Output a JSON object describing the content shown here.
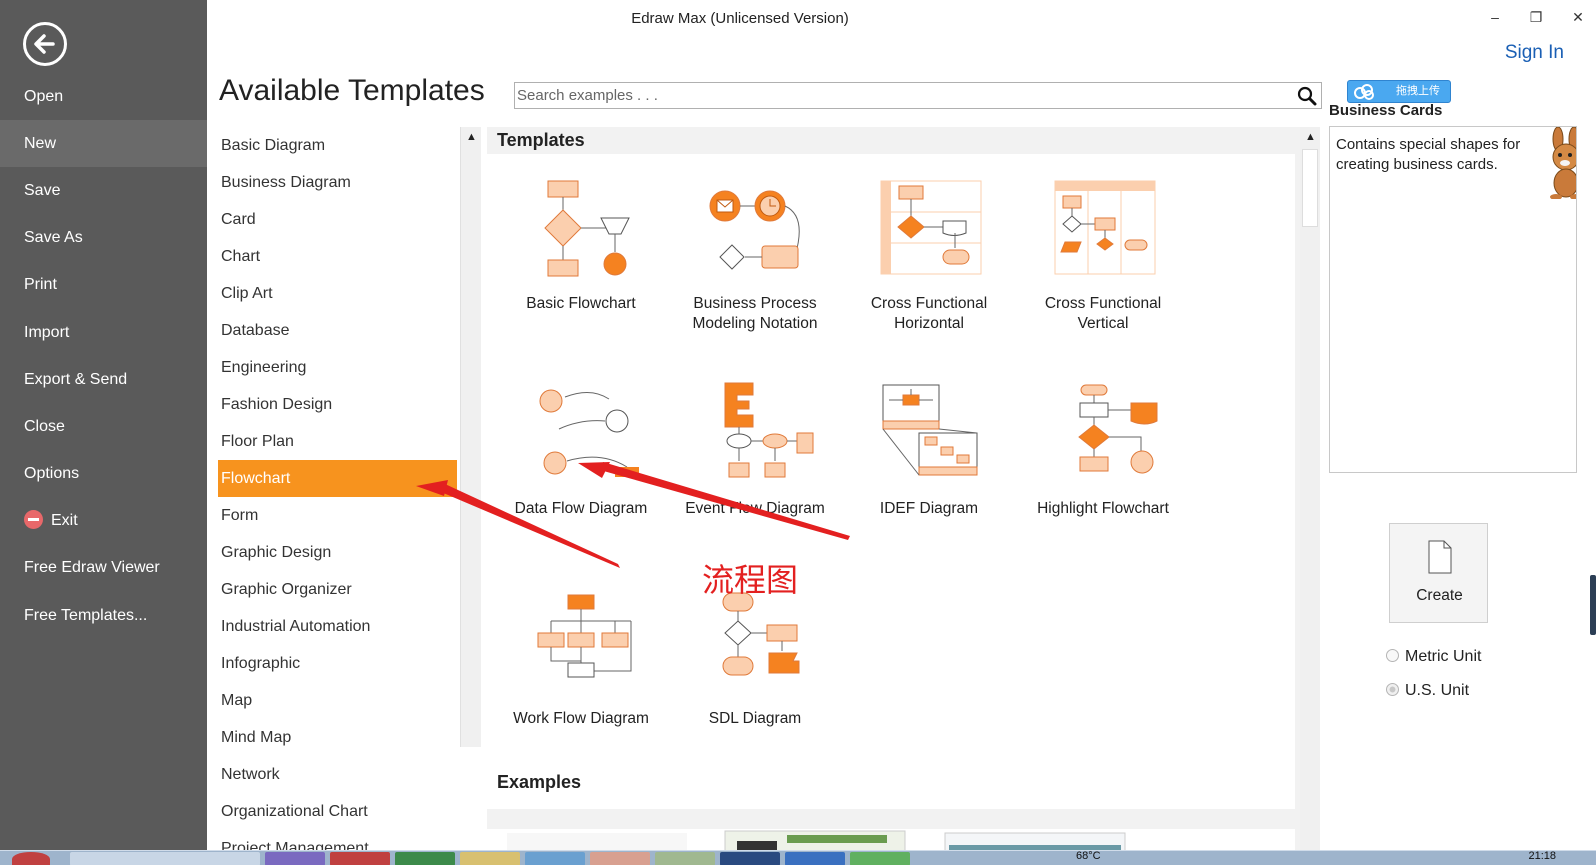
{
  "window": {
    "title": "Edraw Max (Unlicensed Version)",
    "sign_in": "Sign In",
    "minimize": "–",
    "restore": "❐",
    "close": "✕"
  },
  "leftnav": {
    "items": [
      {
        "label": "Open"
      },
      {
        "label": "New"
      },
      {
        "label": "Save"
      },
      {
        "label": "Save As"
      },
      {
        "label": "Print"
      },
      {
        "label": "Import"
      },
      {
        "label": "Export & Send"
      },
      {
        "label": "Close"
      },
      {
        "label": "Options"
      },
      {
        "label": "Exit",
        "icon": "exit-icon"
      },
      {
        "label": "Free Edraw Viewer"
      },
      {
        "label": "Free Templates..."
      }
    ],
    "active": "New",
    "back_icon": "back-arrow-icon"
  },
  "heading": "Available Templates",
  "search": {
    "placeholder": "Search examples . . .",
    "icon": "search-icon"
  },
  "categories": [
    "Basic Diagram",
    "Business Diagram",
    "Card",
    "Chart",
    "Clip Art",
    "Database",
    "Engineering",
    "Fashion Design",
    "Floor Plan",
    "Flowchart",
    "Form",
    "Graphic Design",
    "Graphic Organizer",
    "Industrial Automation",
    "Infographic",
    "Map",
    "Mind Map",
    "Network",
    "Organizational Chart",
    "Project Management"
  ],
  "selected_category": "Flowchart",
  "templates_section": "Templates",
  "examples_section": "Examples",
  "templates": [
    {
      "label_line1": "Basic Flowchart",
      "label_line2": ""
    },
    {
      "label_line1": "Business Process",
      "label_line2": "Modeling Notation"
    },
    {
      "label_line1": "Cross Functional",
      "label_line2": "Horizontal"
    },
    {
      "label_line1": "Cross Functional",
      "label_line2": "Vertical"
    },
    {
      "label_line1": "Data Flow Diagram",
      "label_line2": ""
    },
    {
      "label_line1": "Event Flow Diagram",
      "label_line2": ""
    },
    {
      "label_line1": "IDEF Diagram",
      "label_line2": ""
    },
    {
      "label_line1": "Highlight Flowchart",
      "label_line2": ""
    },
    {
      "label_line1": "Work Flow Diagram",
      "label_line2": ""
    },
    {
      "label_line1": "SDL Diagram",
      "label_line2": ""
    }
  ],
  "upload_badge": "拖拽上传",
  "preview": {
    "title": "Business Cards",
    "description": "Contains special shapes for creating business cards."
  },
  "create_label": "Create",
  "units": {
    "metric": "Metric Unit",
    "us": "U.S. Unit",
    "selected": "U.S. Unit"
  },
  "annotation": {
    "text": "流程图",
    "color": "#e32020"
  },
  "taskbar": {
    "temperature": "68°C",
    "time": "21:18"
  },
  "colors": {
    "accent": "#f7931e",
    "shape_fill": "#fbcfae",
    "shape_stroke": "#e07a3a",
    "nav_bg": "#5a5a5a",
    "link": "#1a5fb4"
  }
}
